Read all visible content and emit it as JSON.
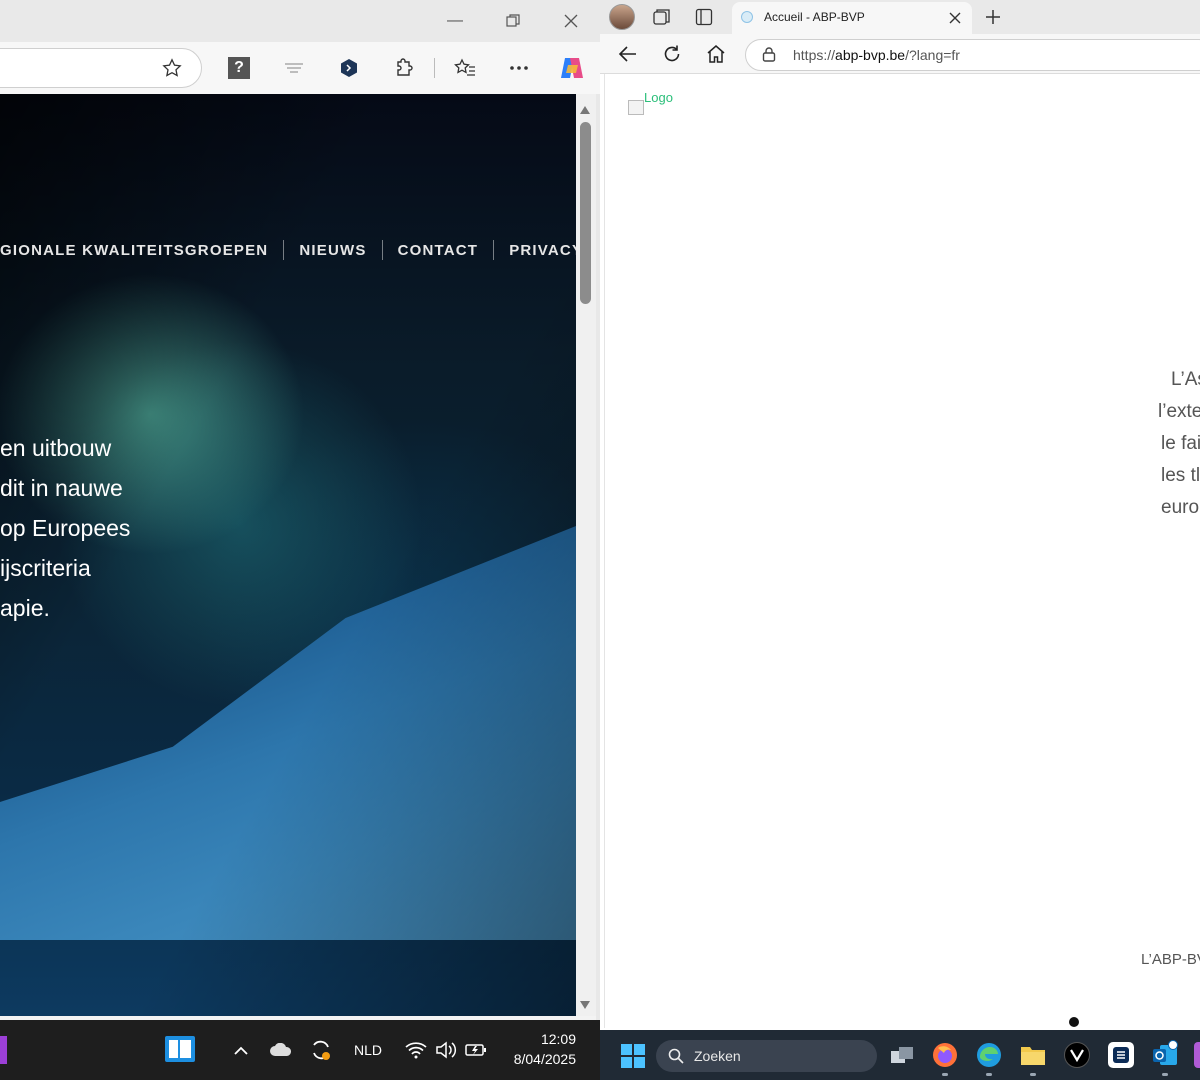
{
  "left_window": {
    "site_nav": [
      "GIONALE KWALITEITSGROEPEN",
      "NIEUWS",
      "CONTACT",
      "PRIVACY"
    ],
    "hero_lines": [
      "en uitbouw",
      "dit in nauwe",
      "op Europees",
      "ijscriteria",
      "apie."
    ],
    "taskbar": {
      "language": "NLD",
      "time": "12:09",
      "date": "8/04/2025"
    }
  },
  "right_window": {
    "tab_title": "Accueil - ABP-BVP",
    "url": {
      "scheme": "https://",
      "host": "abp-bvp.be",
      "path": "/?lang=fr"
    },
    "logo_alt": "Logo",
    "body_lines": [
      "L’As",
      "l’exte",
      "le fai",
      "les tl",
      "euro"
    ],
    "footer_text": "L’ABP-BV",
    "taskbar": {
      "search_placeholder": "Zoeken"
    }
  },
  "colors": {
    "accent_green": "#2bbf7a",
    "taskbar_dark": "#1e1e1e",
    "taskbar_blue": "#202a35"
  }
}
